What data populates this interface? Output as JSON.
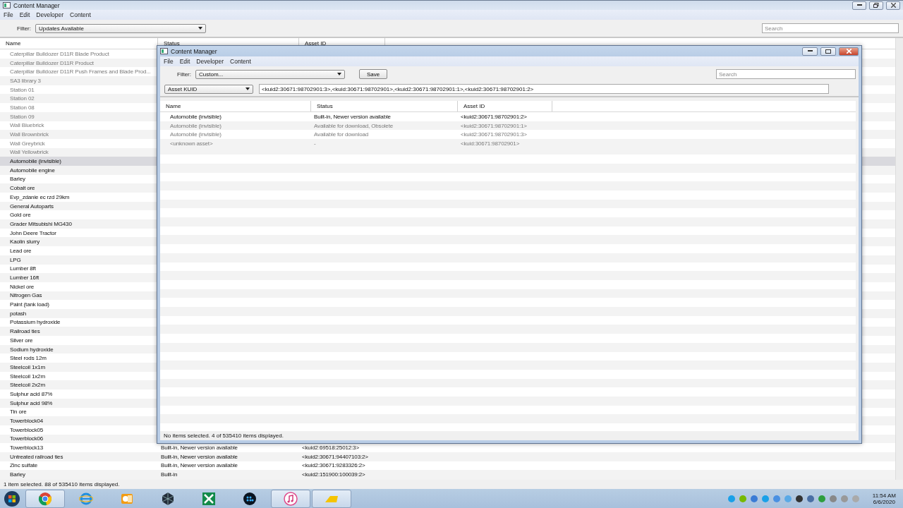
{
  "window": {
    "title": "Content Manager",
    "menu": [
      "File",
      "Edit",
      "Developer",
      "Content"
    ],
    "filter_label": "Filter:",
    "filter_value": "Updates Available",
    "search": {
      "placeholder": "Search"
    },
    "table": {
      "columns": [
        "Name",
        "Status",
        "Asset ID"
      ],
      "rows": [
        {
          "name": "Caterpillar Bulldozer D11R Blade Product",
          "greyed": true,
          "selected": false
        },
        {
          "name": "Caterpillar Bulldozer D11R Product",
          "greyed": true,
          "selected": false
        },
        {
          "name": "Caterpillar Bulldozer D11R Push Frames and Blade Prod...",
          "greyed": true,
          "selected": false
        },
        {
          "name": "SA3 library 3",
          "greyed": true,
          "selected": false
        },
        {
          "name": "Station 01",
          "greyed": true,
          "selected": false
        },
        {
          "name": "Station 02",
          "greyed": true,
          "selected": false
        },
        {
          "name": "Station 08",
          "greyed": true,
          "selected": false
        },
        {
          "name": "Station 09",
          "greyed": true,
          "selected": false
        },
        {
          "name": "Wall Bluebrick",
          "greyed": true,
          "selected": false
        },
        {
          "name": "Wall Brownbrick",
          "greyed": true,
          "selected": false
        },
        {
          "name": "Wall Greybrick",
          "greyed": true,
          "selected": false
        },
        {
          "name": "Wall Yellowbrick",
          "greyed": true,
          "selected": false
        },
        {
          "name": "Automobile (invisible)",
          "greyed": false,
          "selected": true
        },
        {
          "name": "Automobile engine",
          "greyed": false,
          "selected": false
        },
        {
          "name": "Barley",
          "greyed": false,
          "selected": false
        },
        {
          "name": "Cobalt ore",
          "greyed": false,
          "selected": false
        },
        {
          "name": "Evp_zdanie ec rzd 29km",
          "greyed": false,
          "selected": false
        },
        {
          "name": "General Autoparts",
          "greyed": false,
          "selected": false
        },
        {
          "name": "Gold ore",
          "greyed": false,
          "selected": false
        },
        {
          "name": "Grader Mitsubishi MG430",
          "greyed": false,
          "selected": false
        },
        {
          "name": "John Deere Tractor",
          "greyed": false,
          "selected": false
        },
        {
          "name": "Kaolin slurry",
          "greyed": false,
          "selected": false
        },
        {
          "name": "Lead ore",
          "greyed": false,
          "selected": false
        },
        {
          "name": "LPG",
          "greyed": false,
          "selected": false
        },
        {
          "name": "Lumber 8ft",
          "greyed": false,
          "selected": false
        },
        {
          "name": "Lumber 16ft",
          "greyed": false,
          "selected": false
        },
        {
          "name": "Nickel ore",
          "greyed": false,
          "selected": false
        },
        {
          "name": "Nitrogen Gas",
          "greyed": false,
          "selected": false
        },
        {
          "name": "Paint (tank load)",
          "greyed": false,
          "selected": false
        },
        {
          "name": "potash",
          "greyed": false,
          "selected": false
        },
        {
          "name": "Potassium hydroxide",
          "greyed": false,
          "selected": false
        },
        {
          "name": "Railroad ties",
          "greyed": false,
          "selected": false
        },
        {
          "name": "Silver ore",
          "greyed": false,
          "selected": false
        },
        {
          "name": "Sodium hydroxide",
          "greyed": false,
          "selected": false
        },
        {
          "name": "Steel rods 12m",
          "greyed": false,
          "selected": false
        },
        {
          "name": "Steelcoil 1x1m",
          "greyed": false,
          "selected": false
        },
        {
          "name": "Steelcoil 1x2m",
          "greyed": false,
          "selected": false
        },
        {
          "name": "Steelcoil 2x2m",
          "greyed": false,
          "selected": false
        },
        {
          "name": "Sulphur acid 87%",
          "greyed": false,
          "selected": false
        },
        {
          "name": "Sulphur acid 98%",
          "greyed": false,
          "selected": false
        },
        {
          "name": "Tin ore",
          "greyed": false,
          "selected": false
        },
        {
          "name": "Towerblock04",
          "greyed": false,
          "selected": false
        },
        {
          "name": "Towerblock05",
          "greyed": false,
          "selected": false
        },
        {
          "name": "Towerblock06",
          "greyed": false,
          "selected": false
        },
        {
          "name": "Towerblock13",
          "status": "Built-in, Newer version available",
          "asset_id": "<kuid2:69518:25012:3>",
          "greyed": false,
          "selected": false
        },
        {
          "name": "Untreated railroad ties",
          "status": "Built-in, Newer version available",
          "asset_id": "<kuid2:30671:94407103:2>",
          "greyed": false,
          "selected": false
        },
        {
          "name": "Zinc sulfate",
          "status": "Built-in, Newer version available",
          "asset_id": "<kuid2:30671:9283326:2>",
          "greyed": false,
          "selected": false
        },
        {
          "name": "Barley",
          "status": "Built-in",
          "asset_id": "<kuid2:151900:100039:2>",
          "greyed": false,
          "selected": false
        }
      ]
    },
    "status_bar": "1 item selected. 88 of 535410 items displayed."
  },
  "dialog": {
    "title": "Content Manager",
    "menu": [
      "File",
      "Edit",
      "Developer",
      "Content"
    ],
    "filter_label": "Filter:",
    "filter_value": "Custom...",
    "save_button": "Save",
    "search": {
      "placeholder": "Search"
    },
    "field_select": "Asset KUID",
    "query": "<kuid2:30671:98702901:3>,<kuid:30671:98702901>,<kuid2:30671:98702901:1>,<kuid2:30671:98702901:2>",
    "table": {
      "columns": [
        "Name",
        "Status",
        "Asset ID"
      ],
      "rows": [
        {
          "name": "Automobile (invisible)",
          "status": "Built-in, Newer version available",
          "asset_id": "<kuid2:30671:98702901:2>",
          "greyed": false
        },
        {
          "name": "Automobile (invisible)",
          "status": "Available for download, Obsolete",
          "asset_id": "<kuid2:30671:98702901:1>",
          "greyed": true
        },
        {
          "name": "Automobile (invisible)",
          "status": "Available for download",
          "asset_id": "<kuid2:30671:98702901:3>",
          "greyed": true
        },
        {
          "name": "<unknown asset>",
          "status": "-",
          "asset_id": "<kuid:30671:98702901>",
          "greyed": true
        }
      ]
    },
    "status_bar": "No items selected. 4 of 535410 items displayed."
  },
  "taskbar": {
    "apps": [
      {
        "active": true
      },
      {
        "active": false
      },
      {
        "active": false
      },
      {
        "active": false
      },
      {
        "active": false
      },
      {
        "active": false
      },
      {
        "active": true
      },
      {
        "active": true
      }
    ],
    "time": "11:54 AM",
    "date": "6/6/2020"
  }
}
